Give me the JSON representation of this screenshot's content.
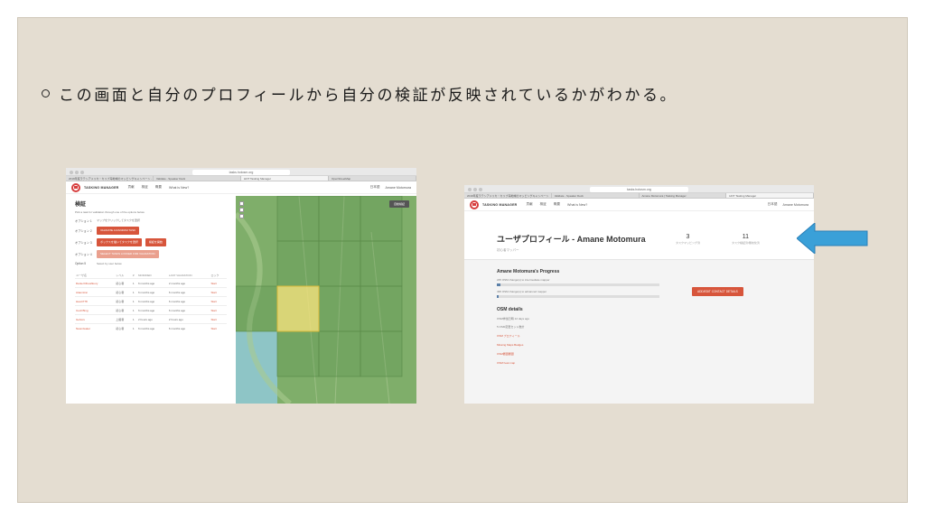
{
  "slide": {
    "bullet_text": "この画面と自分のプロフィールから自分の検証が反映されているかがわかる。"
  },
  "left_shot": {
    "url": "tasks.hotosm.org",
    "tabs": [
      "2019年度ラテンアメリカ・カリブ海地域のマッピングキャンペーン - Google ドライブ",
      "Validate - Speaker Deck",
      "HOT Tasking Manager",
      "OpenStreetMap"
    ],
    "nav": {
      "brand": "TASKING MANAGER",
      "links": [
        "貢献",
        "検証",
        "概要",
        "What is New?"
      ],
      "lang": "日本語",
      "user": "Amane Motomura"
    },
    "panel": {
      "title": "検証",
      "desc": "Pick a task for validation through one of the options below.",
      "option1_label": "オプション 1",
      "option1_text": "マップをクリックしてタスクを選択",
      "option2_label": "オプション 2",
      "option2_btn": "VALIDATE A RANDOM TASK",
      "option3_label": "オプション 3",
      "option3_btn_a": "ボックスを描いてタスクを選択",
      "option3_btn_b": "検証を開始",
      "option4_label": "オプション 4",
      "option4_btn": "SELECT TASKS LOCKED FOR VALIDATION",
      "option5_label": "Option 5",
      "option5_text": "Select by user below",
      "table_headers": [
        "ユーザ名",
        "レベル",
        "#",
        "MODIFIED",
        "LAST VALIDATION",
        "ロック"
      ],
      "rows": [
        [
          "Daniel Dhewfloury",
          "初心者",
          "1",
          "6 months ago",
          "2 months ago",
          "Start"
        ],
        [
          "Ataumirai",
          "初心者",
          "1",
          "6 months ago",
          "6 months ago",
          "Start"
        ],
        [
          "Haozi778",
          "初心者",
          "1",
          "6 months ago",
          "6 months ago",
          "Start"
        ],
        [
          "Cecil Bing",
          "初心者",
          "1",
          "6 months ago",
          "6 months ago",
          "Start"
        ],
        [
          "Gehoru",
          "上級者",
          "1",
          "2 hours ago",
          "2 hours ago",
          "Start"
        ],
        [
          "Naomiwater",
          "初心者",
          "1",
          "6 months ago",
          "6 months ago",
          "Start"
        ]
      ]
    },
    "map_button": "自動検証"
  },
  "right_shot": {
    "url": "tasks.hotosm.org",
    "tabs": [
      "2019年度ラテンアメリカ・カリブ海地域のマッピングキャンペーン",
      "Validate - Speaker Deck",
      "Amane Motomura | Tasking Manager",
      "HOT Tasking Manager"
    ],
    "nav": {
      "brand": "TASKING MANAGER",
      "links": [
        "貢献",
        "検証",
        "概要",
        "What is New?"
      ],
      "lang": "日本語",
      "user": "Amane Motomura"
    },
    "profile": {
      "title": "ユーザプロフィール - Amane Motomura",
      "level": "初心者マッパー",
      "stats": [
        {
          "num": "3",
          "label": "タスクマッピング済"
        },
        {
          "num": "11",
          "label": "タスク検証済/無効化済"
        }
      ],
      "progress_title": "Amane Motomura's Progress",
      "progress": [
        {
          "text": "245 OSM change(s) to intermediate mapper",
          "fraction": 0.02
        },
        {
          "text": "495 OSM change(s) to advanced mapper",
          "fraction": 0.01
        }
      ],
      "add_button": "ADD/EDIT CONTACT DETAILS",
      "osm_title": "OSM details",
      "osm_lines": [
        "OSM参加日時 12 days ago",
        "5 OSM変更セット数計"
      ],
      "osm_links": [
        "OSM プロフィール",
        "Missing Maps Badges",
        "OSM履歴履歴",
        "OSM heat map"
      ]
    }
  },
  "colors": {
    "slide_bg": "#e4ddd1",
    "accent": "#d7553b",
    "arrow": "#3aa0d8"
  }
}
